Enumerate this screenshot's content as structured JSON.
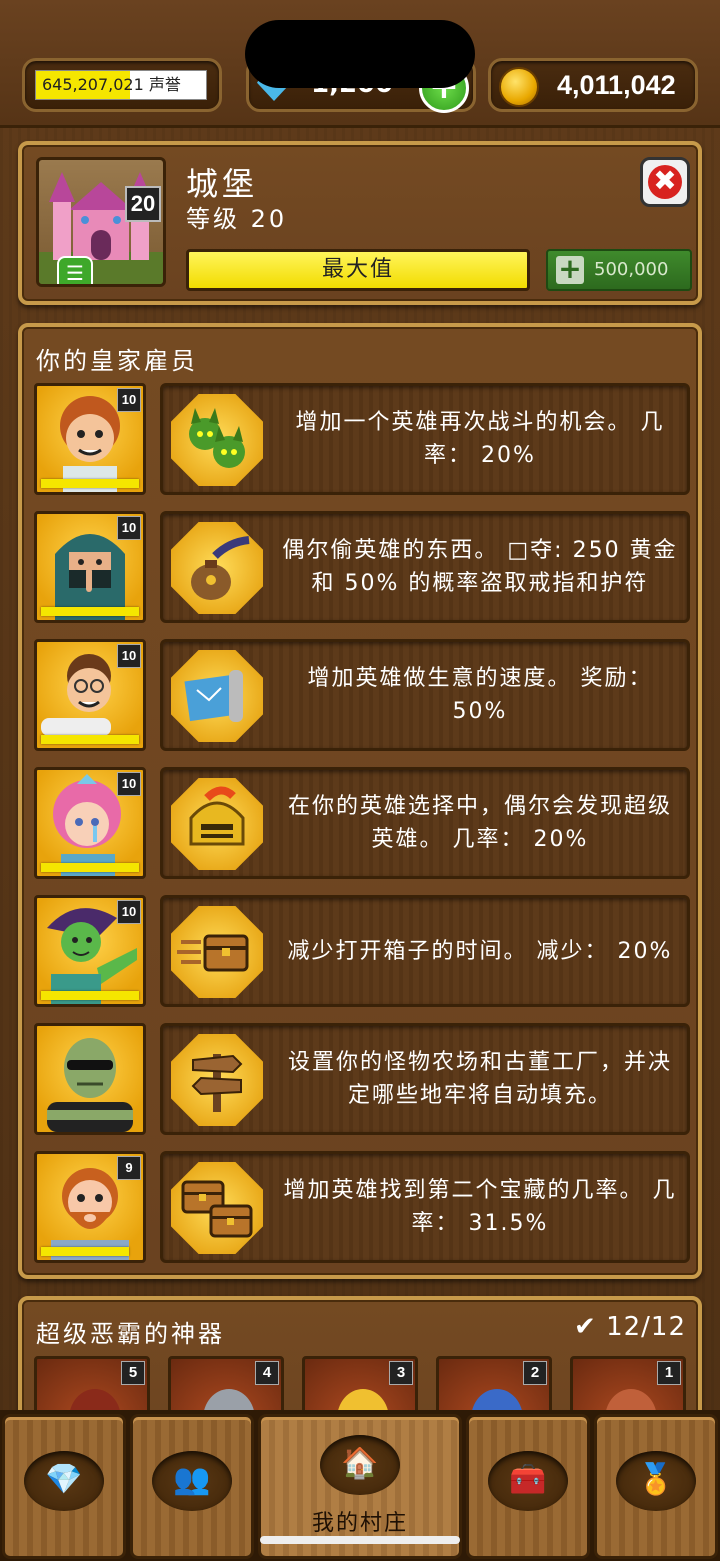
{
  "currency": {
    "reputation": {
      "value": "645,207,021",
      "label": "声誉",
      "fill_fraction": 0.55
    },
    "gems": {
      "value": "1,200",
      "plus": "+"
    },
    "gold": {
      "value": "4,011,042"
    }
  },
  "building": {
    "name": "城堡",
    "level_text": "等级 20",
    "level_badge": "20",
    "max_label": "最大值",
    "upgrade_cost": "500,000",
    "close_symbol": "✖",
    "list_symbol": "☰"
  },
  "staff": {
    "title": "你的皇家雇员",
    "rows": [
      {
        "level": "10",
        "progress": 1.0,
        "icon": "goblin-heads-icon",
        "text": "增加一个英雄再次战斗的机会。 几率： 20%"
      },
      {
        "level": "10",
        "progress": 1.0,
        "icon": "money-bag-hand-icon",
        "text": "偶尔偷英雄的东西。 □夺: 250 黄金和 50% 的概率盗取戒指和护符"
      },
      {
        "level": "10",
        "progress": 1.0,
        "icon": "map-scroll-icon",
        "text": "增加英雄做生意的速度。 奖励： 50%"
      },
      {
        "level": "10",
        "progress": 1.0,
        "icon": "knight-helmet-icon",
        "text": "在你的英雄选择中，偶尔会发现超级英雄。 几率： 20%"
      },
      {
        "level": "10",
        "progress": 1.0,
        "icon": "fast-chest-icon",
        "text": "减少打开箱子的时间。 减少： 20%"
      },
      {
        "level": "",
        "progress": 0,
        "icon": "signpost-icon",
        "text": "设置你的怪物农场和古董工厂，并决定哪些地牢将自动填充。"
      },
      {
        "level": "9",
        "progress": 0.9,
        "icon": "two-chests-icon",
        "text": "增加英雄找到第二个宝藏的几率。 几率： 31.5%"
      }
    ]
  },
  "artifacts": {
    "title": "超级恶霸的神器",
    "count": "12/12",
    "check": "✔",
    "slots": [
      {
        "num": "5",
        "color": "#8a2a1a"
      },
      {
        "num": "4",
        "color": "#9aa0a8"
      },
      {
        "num": "3",
        "color": "#f0c030"
      },
      {
        "num": "2",
        "color": "#3a6ac8"
      },
      {
        "num": "1",
        "color": "#c0603a"
      }
    ]
  },
  "nav": {
    "items": [
      {
        "name": "gems",
        "icon": "diamond-icon",
        "glyph": "💎"
      },
      {
        "name": "heroes",
        "icon": "group-icon",
        "glyph": "👥"
      },
      {
        "name": "village",
        "icon": "house-icon",
        "glyph": "🏠",
        "label": "我的村庄",
        "active": true
      },
      {
        "name": "chests",
        "icon": "chest-icon",
        "glyph": "🧰"
      },
      {
        "name": "achievements",
        "icon": "medal-icon",
        "glyph": "🏅"
      }
    ]
  }
}
